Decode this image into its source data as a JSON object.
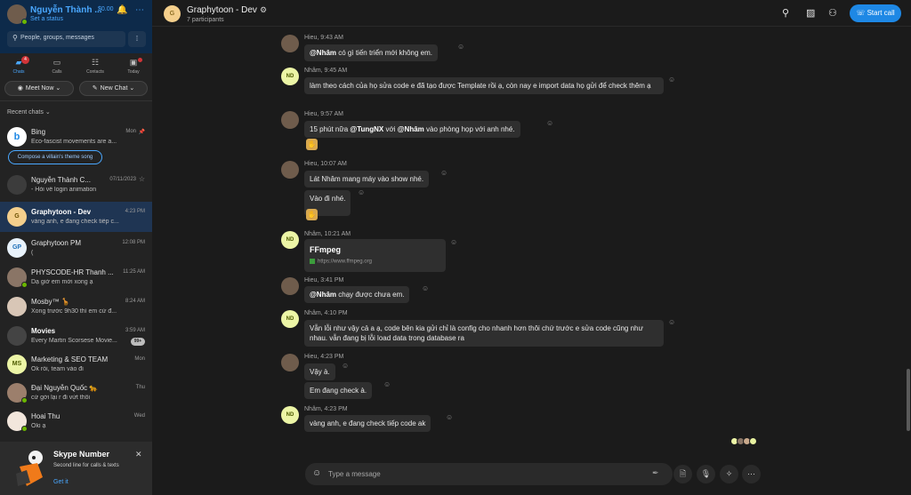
{
  "profile": {
    "name": "Nguyễn Thành ...",
    "status": "Set a status",
    "credit": "$0.00"
  },
  "search": {
    "placeholder": "People, groups, messages"
  },
  "nav": [
    {
      "label": "Chats",
      "badge": "4",
      "icon": "chat-icon"
    },
    {
      "label": "Calls",
      "icon": "video-icon"
    },
    {
      "label": "Contacts",
      "icon": "contacts-icon"
    },
    {
      "label": "Today",
      "icon": "today-icon"
    }
  ],
  "buttons": {
    "meet_now": "Meet Now",
    "new_chat": "New Chat"
  },
  "recent_title": "Recent chats",
  "chats": [
    {
      "name": "Bing",
      "preview": "Eco-fascist movements are a...",
      "time": "Mon",
      "avatar": "b"
    },
    {
      "name": "Nguyễn Thành C...",
      "preview": "- Hỏi về login animation",
      "time": "07/11/2023",
      "avatar": ""
    },
    {
      "name": "Graphytoon - Dev",
      "preview": "vàng anh, e đang check tiếp c...",
      "time": "4:23 PM",
      "avatar": "G"
    },
    {
      "name": "Graphytoon PM",
      "preview": "(",
      "time": "12:08 PM",
      "avatar": "GP"
    },
    {
      "name": "PHYSCODE-HR Thanh ...",
      "preview": "Dạ giờ em mới xong ạ",
      "time": "11:25 AM",
      "avatar": ""
    },
    {
      "name": "Mosby™ 🦒",
      "preview": "Xong trước 9h30 thì em cứ đ...",
      "time": "8:24 AM",
      "avatar": ""
    },
    {
      "name": "Movies",
      "preview": "Every Martin Scorsese Movie...",
      "time": "3:59 AM",
      "count": "99+",
      "avatar": ""
    },
    {
      "name": "Marketing & SEO TEAM",
      "preview": "Ok rồi, team vào đi",
      "time": "Mon",
      "avatar": "MS"
    },
    {
      "name": "Đại Nguyễn Quốc 🐆",
      "preview": "cứ gởi lại r đi vứt thôi",
      "time": "Thu",
      "avatar": ""
    },
    {
      "name": "Hoai Thu",
      "preview": "Oki ạ",
      "time": "Wed",
      "avatar": ""
    }
  ],
  "compose_pill": "Compose a villain's theme song",
  "skype_number": {
    "title": "Skype Number",
    "subtitle": "Second line for calls & texts",
    "link": "Get it"
  },
  "header": {
    "avatar": "G",
    "title": "Graphytoon - Dev",
    "participants": "7 participants",
    "start_call": "Start call"
  },
  "messages": {
    "m1": {
      "meta": "Hieu, 9:43 AM",
      "mention": "@Nhâm",
      "text": " có gì tiến triển mới không em."
    },
    "m2": {
      "meta": "Nhâm, 9:45 AM",
      "text": "làm theo cách của họ sửa code e đã tạo được Template rồi ạ, còn nay e import data họ gửi để check thêm ạ"
    },
    "m3": {
      "meta": "Hieu, 9:57 AM",
      "t1": "15 phút nữa ",
      "mention1": "@TungNX",
      "t2": " với ",
      "mention2": "@Nhâm",
      "t3": " vào phòng họp với anh nhé."
    },
    "m4": {
      "meta": "Hieu, 10:07 AM",
      "text1": "Lát Nhâm mang máy vào show nhé.",
      "text2": "Vào đi nhé."
    },
    "m5": {
      "meta": "Nhâm, 10:21 AM",
      "link_title": "FFmpeg",
      "link_url": "https://www.ffmpeg.org"
    },
    "m6": {
      "meta": "Hieu, 3:41 PM",
      "mention": "@Nhâm",
      "text": " chạy được chưa em."
    },
    "m7": {
      "meta": "Nhâm, 4:10 PM",
      "text": "Vẫn lỗi như vậy cả a ạ, code bên kia gửi chỉ là config cho nhanh hơn thôi chứ trước e sửa code cũng như nhau. vẫn đang bị lỗi load data trong database ra"
    },
    "m8": {
      "meta": "Hieu, 4:23 PM",
      "text1": "Vậy à.",
      "text2": "Em đang check à."
    },
    "m9": {
      "meta": "Nhâm, 4:23 PM",
      "text": "vàng anh, e đang check tiếp code ak"
    },
    "nd_initials": "ND"
  },
  "composer": {
    "placeholder": "Type a message"
  },
  "colors": {
    "accent": "#1e88e5",
    "link": "#4aa8ff",
    "presence": "#6bb700",
    "badge": "#d13438"
  }
}
